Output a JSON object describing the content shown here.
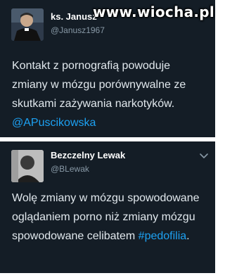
{
  "watermark": "www.wiocha.pl",
  "tweets": [
    {
      "display_name": "ks. Janusz",
      "handle": "@Janusz1967",
      "text_parts": [
        "Kontakt z pornografią powoduje zmiany w mózgu porównywalne ze skutkami zażywania narkotyków. ",
        "@APuscikowska"
      ],
      "avatar_icon": "priest-avatar-icon"
    },
    {
      "display_name": "Bezczelny Lewak",
      "handle": "@BLewak",
      "text_parts": [
        "Wolę zmiany w mózgu spowodowane oglądaniem porno niż zmiany mózgu spowodowane celibatem ",
        "#pedofilia",
        "."
      ],
      "avatar_icon": "person-avatar-icon",
      "menu_icon": "chevron-down-icon"
    }
  ],
  "colors": {
    "background": "#141d26",
    "link": "#1da1f2",
    "handle": "#8899a6",
    "text": "#e1e8ed"
  }
}
